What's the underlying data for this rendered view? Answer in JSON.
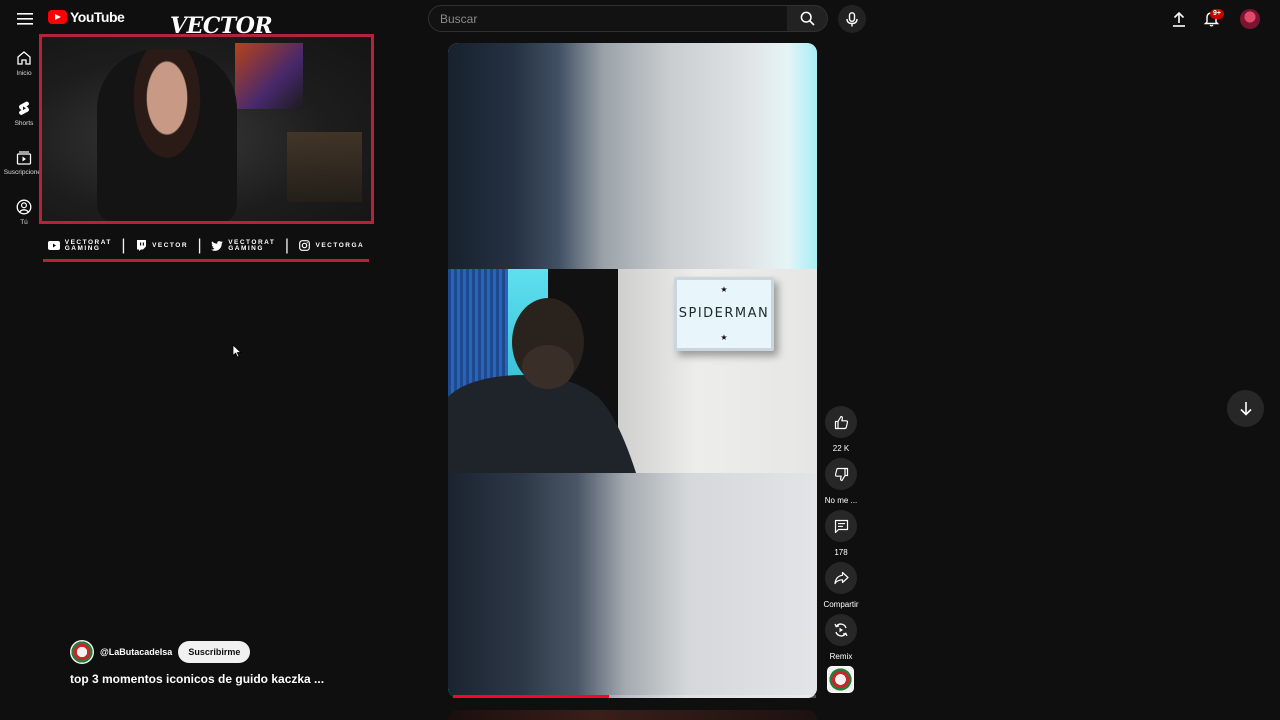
{
  "header": {
    "logo_text": "YouTube",
    "search_placeholder": "Buscar",
    "notification_count": "9+"
  },
  "sidebar": {
    "items": [
      {
        "label": "Inicio",
        "icon": "home-icon"
      },
      {
        "label": "Shorts",
        "icon": "shorts-icon"
      },
      {
        "label": "Suscripciones",
        "icon": "subscriptions-icon"
      },
      {
        "label": "Tú",
        "icon": "you-icon"
      }
    ]
  },
  "overlay": {
    "streamer_name": "VECTOR",
    "socials": [
      {
        "icon": "youtube-icon",
        "line1": "VECTORAT",
        "line2": "GAMING"
      },
      {
        "icon": "twitch-icon",
        "line1": "VECTOR",
        "line2": ""
      },
      {
        "icon": "twitter-icon",
        "line1": "VECTORAT",
        "line2": "GAMING"
      },
      {
        "icon": "instagram-icon",
        "line1": "VECTORGA",
        "line2": ""
      }
    ],
    "border_color": "#b3243b"
  },
  "short": {
    "sign_text": "SPIDERMAN",
    "progress_percent": 43,
    "channel_name": "@LaButacadeIsa",
    "subscribe_label": "Suscribirme",
    "title": "top 3 momentos iconicos de guido kaczka ..."
  },
  "actions": {
    "like_count": "22 K",
    "dislike_label": "No me ...",
    "comments_count": "178",
    "share_label": "Compartir",
    "remix_label": "Remix"
  },
  "colors": {
    "background": "#0f0f0f",
    "accent": "#ff0033",
    "button_bg": "#272727"
  }
}
